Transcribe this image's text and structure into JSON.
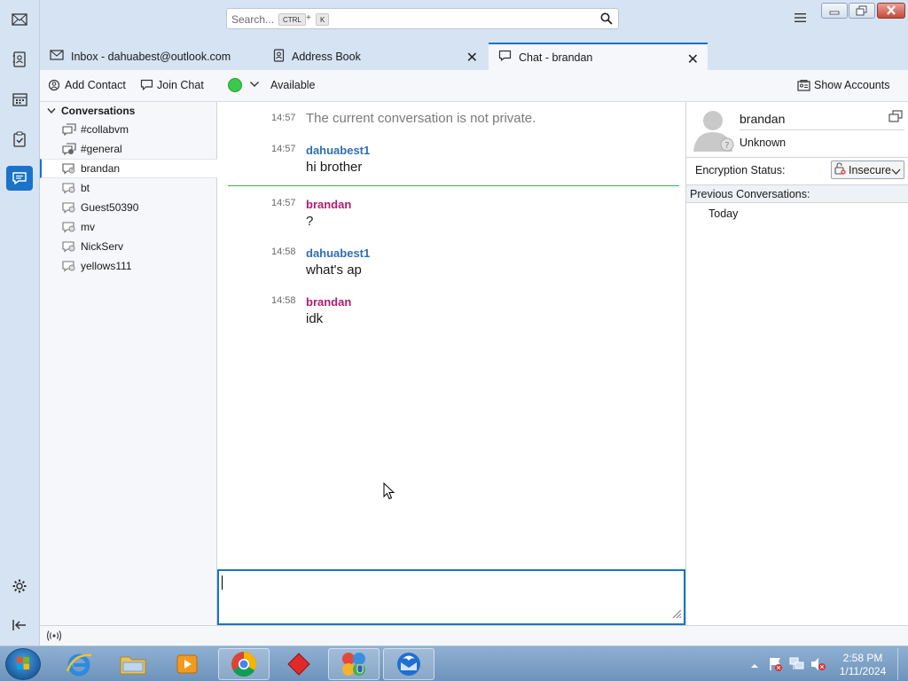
{
  "search": {
    "placeholder": "Search...",
    "shortcut_key1": "CTRL",
    "shortcut_plus": "+",
    "shortcut_key2": "K"
  },
  "tabs": [
    {
      "label": "Inbox - dahuabest@outlook.com",
      "icon": "inbox-tab-icon",
      "active": false
    },
    {
      "label": "Address Book",
      "icon": "address-book-icon",
      "active": false
    },
    {
      "label": "Chat - brandan",
      "icon": "chat-bubble-icon",
      "active": true
    }
  ],
  "toolbar": {
    "add_contact": "Add Contact",
    "join_chat": "Join Chat",
    "status": "Available",
    "status_color": "#3ac94a",
    "show_accounts": "Show Accounts"
  },
  "conversations": {
    "header": "Conversations",
    "items": [
      {
        "label": "#collabvm",
        "selected": false
      },
      {
        "label": "#general",
        "selected": false
      },
      {
        "label": "brandan",
        "selected": true
      },
      {
        "label": "bt",
        "selected": false
      },
      {
        "label": "Guest50390",
        "selected": false
      },
      {
        "label": "mv",
        "selected": false
      },
      {
        "label": "NickServ",
        "selected": false
      },
      {
        "label": "yellows111",
        "selected": false
      }
    ]
  },
  "messages": [
    {
      "time": "14:57",
      "system": "The current conversation is not private."
    },
    {
      "time": "14:57",
      "nick": "dahuabest1",
      "text": "hi brother",
      "color": "#2f6fb3"
    },
    {
      "time": "14:57",
      "nick": "brandan",
      "text": "?",
      "color": "#b01c6e"
    },
    {
      "time": "14:58",
      "nick": "dahuabest1",
      "text": "what's ap",
      "color": "#2f6fb3"
    },
    {
      "time": "14:58",
      "nick": "brandan",
      "text": "idk",
      "color": "#b01c6e"
    }
  ],
  "participant": {
    "name": "brandan",
    "status": "Unknown",
    "encryption_label": "Encryption Status:",
    "encryption_value": "Insecure",
    "previous_label": "Previous Conversations:",
    "previous_items": [
      "Today"
    ]
  },
  "taskbar": {
    "time": "2:58 PM",
    "date": "1/11/2024"
  },
  "colors": {
    "accent": "#1a73c9",
    "unread_divider": "#39b54a"
  }
}
